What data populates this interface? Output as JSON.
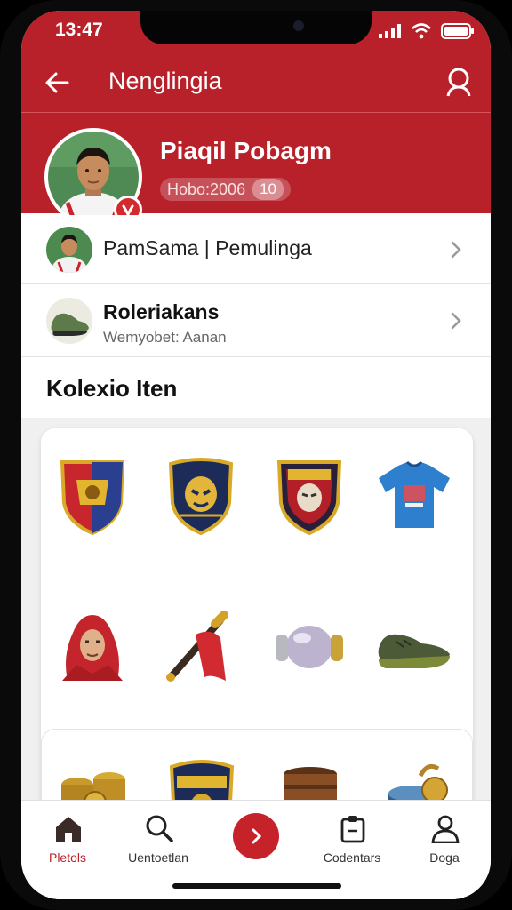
{
  "status_bar": {
    "time": "13:47"
  },
  "header": {
    "title": "Nenglingia"
  },
  "profile": {
    "name": "Piaqil Pobagm",
    "id_text": "Hobo:2006",
    "count": "10"
  },
  "rows": [
    {
      "label": "PamSama | Pemulinga"
    },
    {
      "title": "Roleriakans",
      "subtitle": "Wemyobet: Aanan"
    }
  ],
  "section_title": "Kolexio Iten",
  "collection": [
    {
      "icon": "club-crest-icon"
    },
    {
      "icon": "mask-shield-icon"
    },
    {
      "icon": "red-crest-icon"
    },
    {
      "icon": "blue-jersey-icon"
    },
    {
      "icon": "hooded-head-icon"
    },
    {
      "icon": "flag-bat-icon"
    },
    {
      "icon": "capsule-icon"
    },
    {
      "icon": "shoe-icon"
    },
    {
      "icon": "coin-stack-icon"
    },
    {
      "icon": "crest-shield-icon"
    },
    {
      "icon": "barrel-icon"
    },
    {
      "icon": "blue-coins-icon"
    }
  ],
  "bottom_nav": [
    {
      "label": "Pletols",
      "icon": "home-icon",
      "active": true
    },
    {
      "label": "Uentoetlan",
      "icon": "search-icon",
      "active": false
    },
    {
      "label": "",
      "icon": "chevron-right-icon",
      "active": false
    },
    {
      "label": "Codentars",
      "icon": "clipboard-icon",
      "active": false
    },
    {
      "label": "Doga",
      "icon": "person-icon",
      "active": false
    }
  ],
  "colors": {
    "brand": "#b8202a",
    "background": "#ffffff",
    "grid_bg": "#f0f0f0"
  }
}
